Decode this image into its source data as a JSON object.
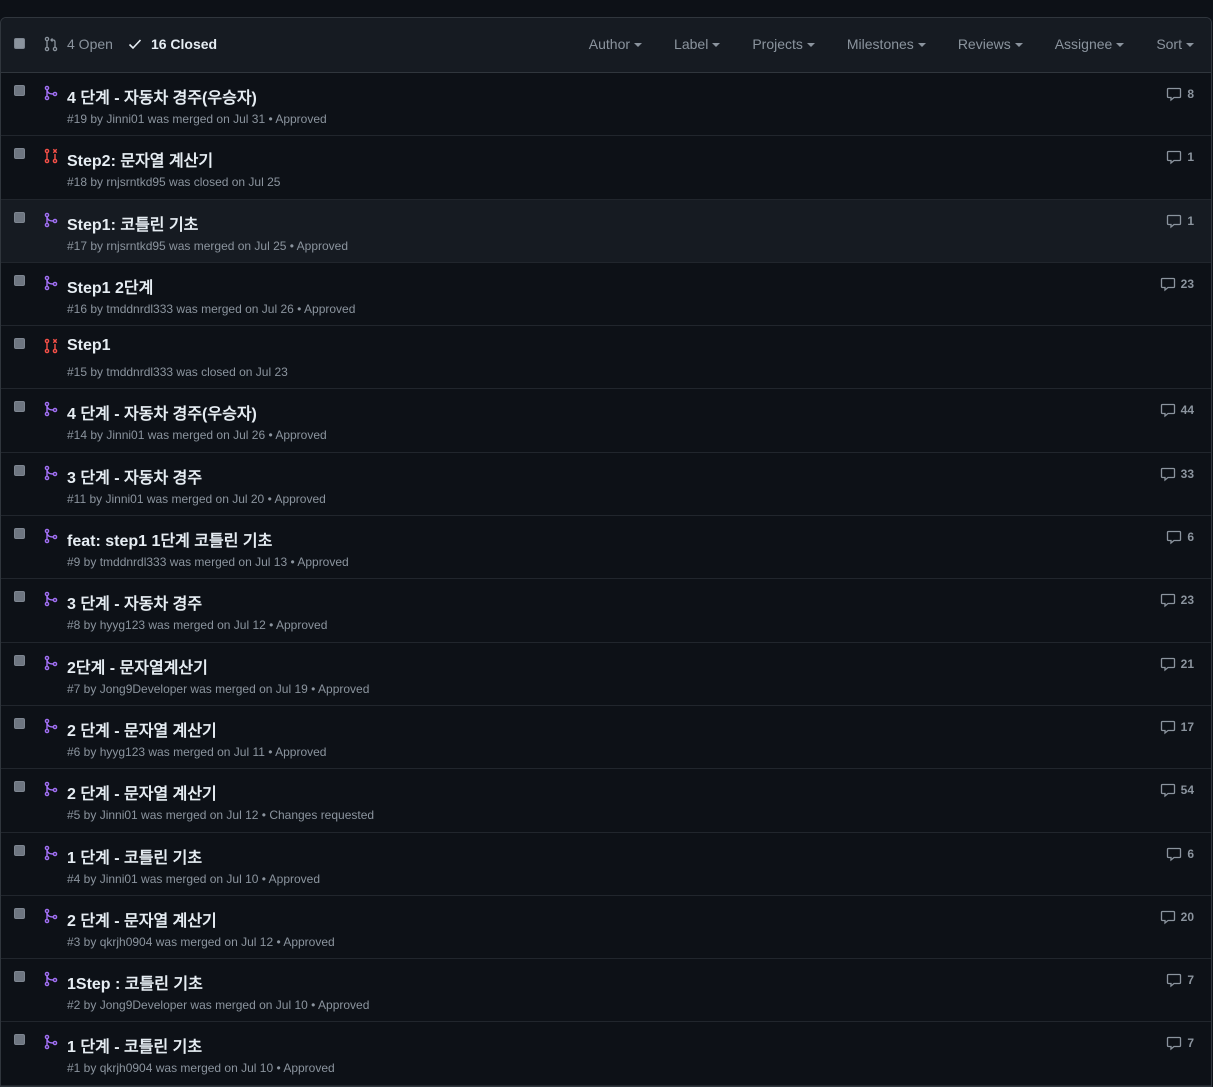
{
  "header": {
    "open_label": "4 Open",
    "closed_label": "16 Closed",
    "filters": [
      "Author",
      "Label",
      "Projects",
      "Milestones",
      "Reviews",
      "Assignee",
      "Sort"
    ]
  },
  "colors": {
    "merged": "#a371f7",
    "closed": "#f85149",
    "background": "#0d1117",
    "header_bg": "#161b22"
  },
  "pull_requests": [
    {
      "title": "4 단계 - 자동차 경주(우승자)",
      "meta": "#19 by Jinni01 was merged on Jul 31 • Approved",
      "comments": "8",
      "state": "merged"
    },
    {
      "title": "Step2: 문자열 계산기",
      "meta": "#18 by rnjsrntkd95 was closed on Jul 25",
      "comments": "1",
      "state": "closed"
    },
    {
      "title": "Step1: 코틀린 기초",
      "meta": "#17 by rnjsrntkd95 was merged on Jul 25 • Approved",
      "comments": "1",
      "state": "merged"
    },
    {
      "title": "Step1 2단계",
      "meta": "#16 by tmddnrdl333 was merged on Jul 26 • Approved",
      "comments": "23",
      "state": "merged"
    },
    {
      "title": "Step1",
      "meta": "#15 by tmddnrdl333 was closed on Jul 23",
      "comments": "",
      "state": "closed"
    },
    {
      "title": "4 단계 - 자동차 경주(우승자)",
      "meta": "#14 by Jinni01 was merged on Jul 26 • Approved",
      "comments": "44",
      "state": "merged"
    },
    {
      "title": "3 단계 - 자동차 경주",
      "meta": "#11 by Jinni01 was merged on Jul 20 • Approved",
      "comments": "33",
      "state": "merged"
    },
    {
      "title": "feat: step1 1단계 코틀린 기초",
      "meta": "#9 by tmddnrdl333 was merged on Jul 13 • Approved",
      "comments": "6",
      "state": "merged"
    },
    {
      "title": "3 단계 - 자동차 경주",
      "meta": "#8 by hyyg123 was merged on Jul 12 • Approved",
      "comments": "23",
      "state": "merged"
    },
    {
      "title": "2단계 - 문자열계산기",
      "meta": "#7 by Jong9Developer was merged on Jul 19 • Approved",
      "comments": "21",
      "state": "merged"
    },
    {
      "title": "2 단계 - 문자열 계산기",
      "meta": "#6 by hyyg123 was merged on Jul 11 • Approved",
      "comments": "17",
      "state": "merged"
    },
    {
      "title": "2 단계 - 문자열 계산기",
      "meta": "#5 by Jinni01 was merged on Jul 12 • Changes requested",
      "comments": "54",
      "state": "merged"
    },
    {
      "title": "1 단계 - 코틀린 기초",
      "meta": "#4 by Jinni01 was merged on Jul 10 • Approved",
      "comments": "6",
      "state": "merged"
    },
    {
      "title": "2 단계 - 문자열 계산기",
      "meta": "#3 by qkrjh0904 was merged on Jul 12 • Approved",
      "comments": "20",
      "state": "merged"
    },
    {
      "title": "1Step : 코틀린 기초",
      "meta": "#2 by Jong9Developer was merged on Jul 10 • Approved",
      "comments": "7",
      "state": "merged"
    },
    {
      "title": "1 단계 - 코틀린 기초",
      "meta": "#1 by qkrjh0904 was merged on Jul 10 • Approved",
      "comments": "7",
      "state": "merged"
    }
  ]
}
